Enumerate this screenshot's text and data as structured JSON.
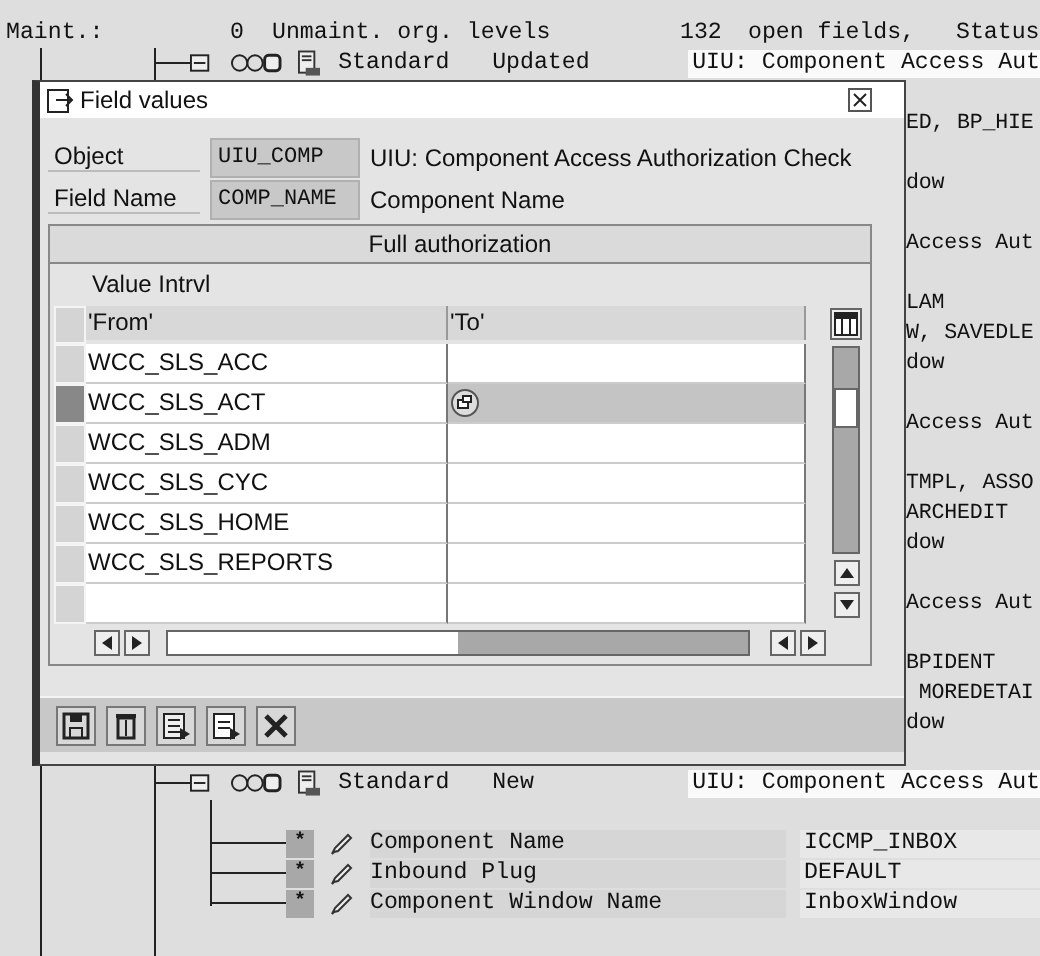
{
  "status_line": {
    "label": "Maint.:",
    "unmaintained_count": "0",
    "unmaintained_label": "Unmaint. org. levels",
    "open_count": "132",
    "open_label": "open fields,",
    "status_label": "Status"
  },
  "tree_rows": [
    {
      "kind": "node",
      "name": "Standard",
      "status": "Updated",
      "text": "UIU: Component Access Aut"
    },
    {
      "kind": "blank"
    },
    {
      "kind": "fragment",
      "text": "ED, BP_HIE"
    },
    {
      "kind": "blank"
    },
    {
      "kind": "fragment",
      "text": "dow"
    },
    {
      "kind": "blank"
    },
    {
      "kind": "fragment",
      "text": "Access Aut"
    },
    {
      "kind": "blank"
    },
    {
      "kind": "fragment",
      "text": "LAM"
    },
    {
      "kind": "fragment",
      "text": "W, SAVEDLE"
    },
    {
      "kind": "fragment",
      "text": "dow"
    },
    {
      "kind": "blank"
    },
    {
      "kind": "fragment",
      "text": "Access Aut"
    },
    {
      "kind": "blank"
    },
    {
      "kind": "fragment",
      "text": "TMPL, ASSO"
    },
    {
      "kind": "fragment",
      "text": "ARCHEDIT"
    },
    {
      "kind": "fragment",
      "text": "dow"
    },
    {
      "kind": "blank"
    },
    {
      "kind": "fragment",
      "text": "Access Aut"
    },
    {
      "kind": "blank"
    },
    {
      "kind": "fragment",
      "text": "BPIDENT"
    },
    {
      "kind": "fragment",
      "text": " MOREDETAI"
    },
    {
      "kind": "fragment",
      "text": "dow"
    },
    {
      "kind": "blank"
    },
    {
      "kind": "node",
      "name": "Standard",
      "status": "New",
      "text": "UIU: Component Access Aut"
    },
    {
      "kind": "blank"
    },
    {
      "kind": "field",
      "marker": "*",
      "label": "Component Name",
      "value": "ICCMP_INBOX"
    },
    {
      "kind": "field",
      "marker": "*",
      "label": "Inbound Plug",
      "value": "DEFAULT"
    },
    {
      "kind": "field",
      "marker": "*",
      "label": "Component Window Name",
      "value": "InboxWindow"
    }
  ],
  "dialog": {
    "title": "Field values",
    "fields": [
      {
        "label": "Object",
        "value": "UIU_COMP",
        "description": "UIU: Component Access Authorization Check"
      },
      {
        "label": "Field Name",
        "value": "COMP_NAME",
        "description": "Component Name"
      }
    ],
    "full_button": "Full authorization",
    "group_title": "Value Intrvl",
    "columns": [
      "'From'",
      "'To'"
    ],
    "rows": [
      {
        "from": "WCC_SLS_ACC",
        "selected": false
      },
      {
        "from": "WCC_SLS_ACT",
        "selected": true
      },
      {
        "from": "WCC_SLS_ADM",
        "selected": false
      },
      {
        "from": "WCC_SLS_CYC",
        "selected": false
      },
      {
        "from": "WCC_SLS_HOME",
        "selected": false
      },
      {
        "from": "WCC_SLS_REPORTS",
        "selected": false
      },
      {
        "selected": false
      }
    ],
    "toolbar": [
      {
        "kind": "save"
      },
      {
        "kind": "delete"
      },
      {
        "kind": "list"
      },
      {
        "kind": "page"
      },
      {
        "kind": "cancel"
      }
    ]
  }
}
